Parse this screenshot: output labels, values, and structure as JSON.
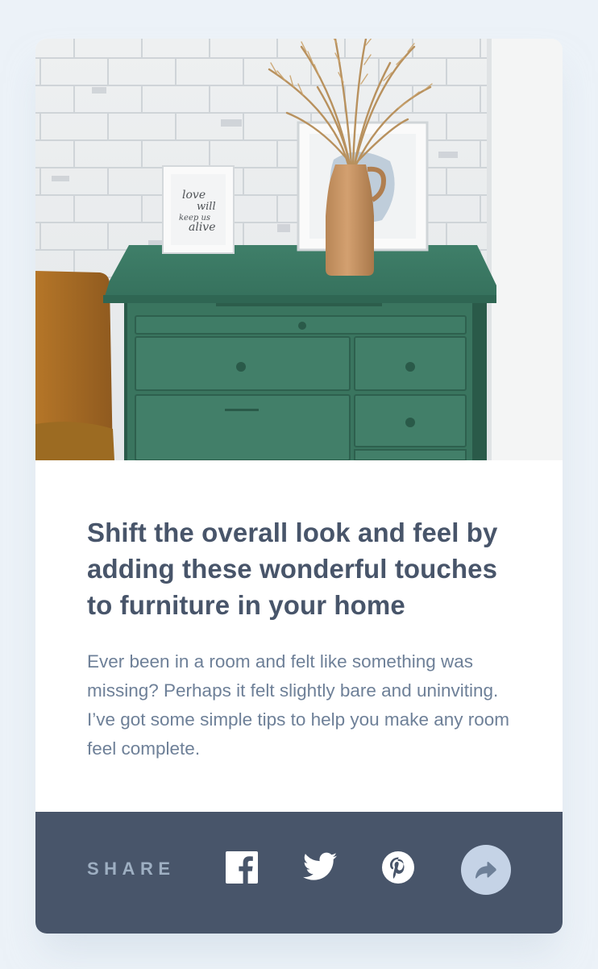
{
  "article": {
    "title": "Shift the overall look and feel by adding these wonderful touches to furniture in your home",
    "description": "Ever been in a room and felt like something was missing? Perhaps it felt slightly bare and uninviting. I’ve got some simple tips to help you make any room feel complete."
  },
  "hero": {
    "frame_text": [
      "love",
      "will",
      "keep us",
      "alive"
    ]
  },
  "share": {
    "label": "SHARE",
    "icons": [
      "facebook-icon",
      "twitter-icon",
      "pinterest-icon",
      "share-arrow-icon"
    ]
  },
  "colors": {
    "page_background": "#ecf2f8",
    "card_background": "#ffffff",
    "title": "#48556a",
    "description": "#6e8098",
    "footer_background": "#48556a",
    "share_label": "#9eafc2",
    "share_button": "#c5d3e6",
    "dresser_green": "#3f7a66"
  }
}
